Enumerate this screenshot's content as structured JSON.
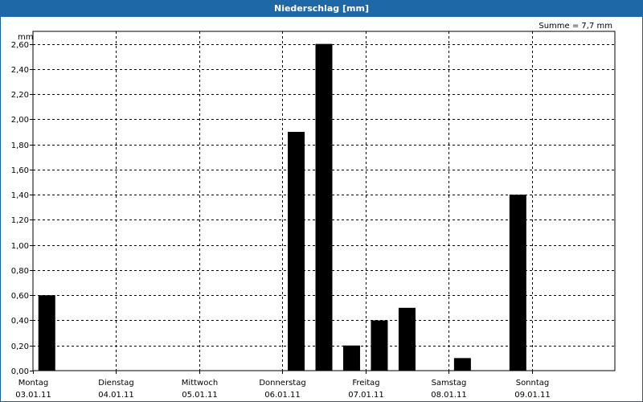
{
  "window": {
    "title": "Niederschlag [mm]"
  },
  "summary": {
    "text": "Summe = 7,7 mm"
  },
  "chart_data": {
    "type": "bar",
    "title": "Niederschlag [mm]",
    "ylabel": "mm",
    "ylim": [
      0,
      2.7
    ],
    "yticks": [
      "0,00",
      "0,20",
      "0,40",
      "0,60",
      "0,80",
      "1,00",
      "1,20",
      "1,40",
      "1,60",
      "1,80",
      "2,00",
      "2,20",
      "2,40",
      "2,60"
    ],
    "grid": true,
    "bar_color": "#000000",
    "x_labels": [
      {
        "day": "Montag",
        "date": "03.01.11"
      },
      {
        "day": "Dienstag",
        "date": "04.01.11"
      },
      {
        "day": "Mittwoch",
        "date": "05.01.11"
      },
      {
        "day": "Donnerstag",
        "date": "06.01.11"
      },
      {
        "day": "Freitag",
        "date": "07.01.11"
      },
      {
        "day": "Samstag",
        "date": "08.01.11"
      },
      {
        "day": "Sonntag",
        "date": "09.01.11"
      }
    ],
    "bars": [
      {
        "period": "Montag 03.01.11, 1. Hälfte",
        "value": 0.6
      },
      {
        "period": "Donnerstag 06.01.11, 2. Hälfte",
        "value": 1.9
      },
      {
        "period": "Freitag 07.01.11, früh",
        "value": 2.6
      },
      {
        "period": "Freitag 07.01.11, Mittag",
        "value": 0.2
      },
      {
        "period": "Freitag 07.01.11, Nachmittag",
        "value": 0.4
      },
      {
        "period": "Freitag 07.01.11, Abend",
        "value": 0.5
      },
      {
        "period": "Samstag 08.01.11, Mittag",
        "value": 0.1
      },
      {
        "period": "Sonntag 09.01.11, früh",
        "value": 1.4
      }
    ]
  }
}
